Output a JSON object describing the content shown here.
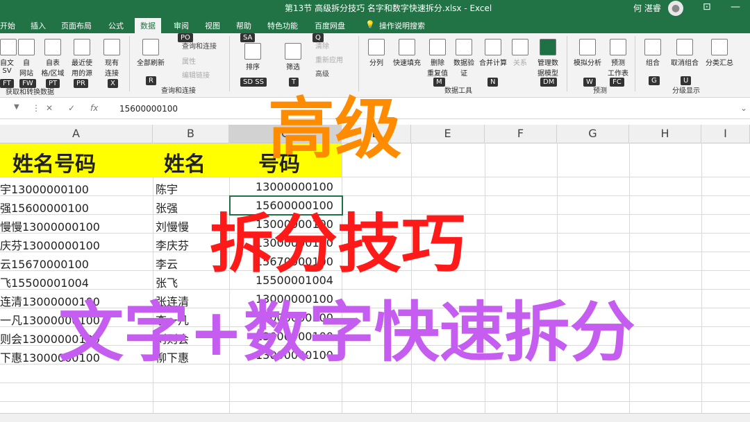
{
  "window": {
    "title": "第13节 高级拆分技巧 名字和数字快速拆分.xlsx - Excel",
    "user": "何 湛睿"
  },
  "tabs": [
    {
      "label": "开始"
    },
    {
      "label": "插入"
    },
    {
      "label": "页面布局"
    },
    {
      "label": "公式"
    },
    {
      "label": "数据",
      "active": true
    },
    {
      "label": "审阅"
    },
    {
      "label": "视图"
    },
    {
      "label": "帮助"
    },
    {
      "label": "特色功能"
    },
    {
      "label": "百度网盘"
    },
    {
      "label": "操作说明搜索"
    }
  ],
  "ribbon": {
    "get_data": [
      {
        "label": "自文\nSV",
        "key": "FT"
      },
      {
        "label": "自\n网站",
        "key": "FW"
      },
      {
        "label": "自表\n格/区域",
        "key": "PT"
      },
      {
        "label": "最近使\n用的源",
        "key": "PR"
      },
      {
        "label": "现有\n连接",
        "key": "X"
      }
    ],
    "get_data_group": "获取和转换数据",
    "refresh_all": {
      "label": "全部刷新",
      "key": "R"
    },
    "queries_small": [
      "查询和连接",
      "属性",
      "编辑链接"
    ],
    "queries_group": "查询和连接",
    "sort_label": "排序",
    "sort_keys": "SD SS",
    "filter_label": "筛选",
    "filter_key": "T",
    "filter_small": [
      "清除",
      "重新应用",
      "高级"
    ],
    "tools": [
      {
        "label": "分列"
      },
      {
        "label": "快速填充"
      },
      {
        "label": "删除\n重复值"
      },
      {
        "label": "数据验\n证"
      },
      {
        "label": "合并计算"
      },
      {
        "label": "关系"
      },
      {
        "label": "管理数\n据模型"
      }
    ],
    "tools_group": "数据工具",
    "tools_keys": [
      "M",
      "N",
      "DM"
    ],
    "forecast": [
      {
        "label": "模拟分析",
        "key": "W"
      },
      {
        "label": "预测\n工作表",
        "key": "FC"
      }
    ],
    "forecast_group": "预测",
    "outline": [
      {
        "label": "组合",
        "key": "G"
      },
      {
        "label": "取消组合",
        "key": "U"
      },
      {
        "label": "分类汇总"
      }
    ],
    "outline_group": "分级显示",
    "extra_keys": [
      "SA",
      "PO",
      "Q"
    ]
  },
  "formula_bar": {
    "value": "15600000100",
    "cancel": "✕",
    "enter": "✓",
    "fx": "fx"
  },
  "columns": [
    "A",
    "B",
    "C",
    "D",
    "E",
    "F",
    "G",
    "H",
    "I"
  ],
  "sheet": {
    "headers": [
      "姓名号码",
      "姓名",
      "号码"
    ],
    "rows": [
      [
        "宇13000000100",
        "陈宇",
        "13000000100"
      ],
      [
        "强15600000100",
        "张强",
        "15600000100"
      ],
      [
        "慢慢13000000100",
        "刘慢慢",
        "13000000100"
      ],
      [
        "庆芬13000000100",
        "李庆芬",
        "13000000100"
      ],
      [
        "云15670000100",
        "李云",
        "15670000100"
      ],
      [
        "飞15500001004",
        "张飞",
        "15500001004"
      ],
      [
        "连清13000000100",
        "张连清",
        "13000000100"
      ],
      [
        "一凡13000000100",
        "李一凡",
        "13000000100"
      ],
      [
        "则会13000000100",
        "刘则会",
        "13000000100"
      ],
      [
        "下惠13000000100",
        "柳下惠",
        "13000000100"
      ]
    ]
  },
  "overlay": {
    "line1": "高级",
    "line2": "拆分技巧",
    "line3": "文字+数字快速拆分",
    "colors": {
      "line1": "#ff8c00",
      "line2": "#ff1a1a",
      "line3": "#c45df0"
    }
  },
  "colors": {
    "excel_green": "#217346",
    "highlight": "#ffff00"
  }
}
